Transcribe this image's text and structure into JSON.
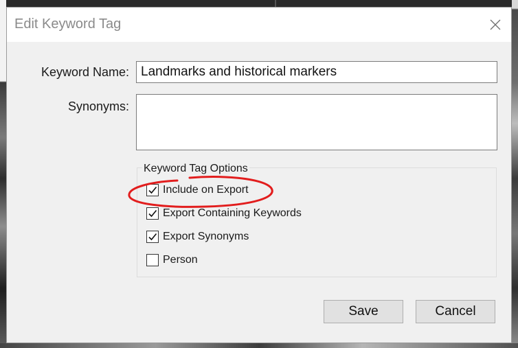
{
  "dialog": {
    "title": "Edit Keyword Tag",
    "close_icon": "close-icon"
  },
  "fields": {
    "keyword_name_label": "Keyword Name:",
    "keyword_name_value": "Landmarks and historical markers",
    "synonyms_label": "Synonyms:",
    "synonyms_value": ""
  },
  "options": {
    "group_label": "Keyword Tag Options",
    "items": [
      {
        "label": "Include on Export",
        "checked": true,
        "highlighted": true
      },
      {
        "label": "Export Containing Keywords",
        "checked": true
      },
      {
        "label": "Export Synonyms",
        "checked": true
      },
      {
        "label": "Person",
        "checked": false
      }
    ],
    "checkmark_icon": "checkmark-icon",
    "highlight_color": "#e21d1d"
  },
  "buttons": {
    "save": "Save",
    "cancel": "Cancel"
  }
}
